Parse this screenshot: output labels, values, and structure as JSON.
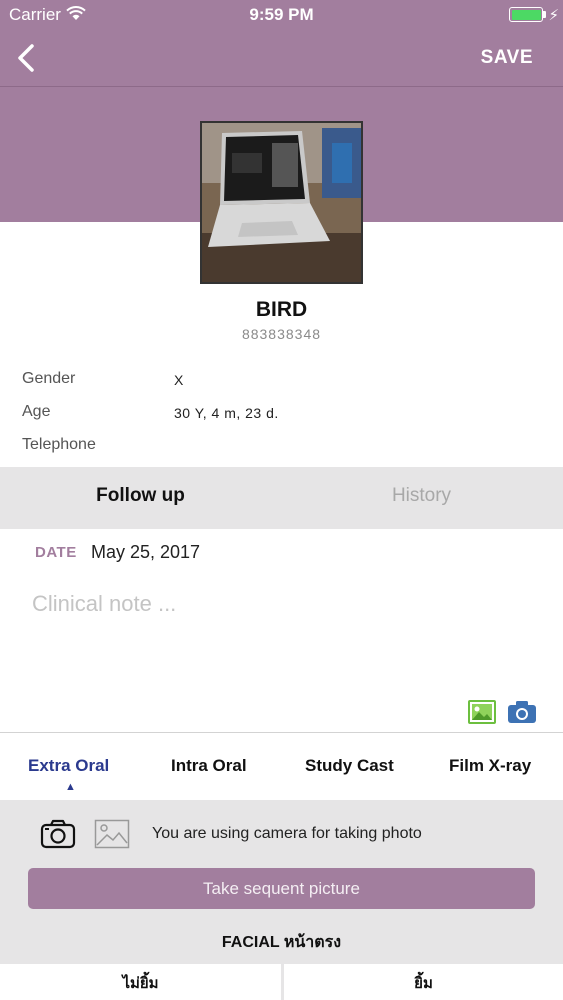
{
  "status_bar": {
    "carrier": "Carrier",
    "time": "9:59 PM"
  },
  "nav": {
    "save_label": "SAVE"
  },
  "patient": {
    "name": "BIRD",
    "id": "883838348",
    "fields": [
      {
        "label": "Gender",
        "value": "X"
      },
      {
        "label": "Age",
        "value": "30 Y, 4 m, 23 d."
      },
      {
        "label": "Telephone",
        "value": ""
      }
    ]
  },
  "tabs": [
    {
      "label": "Follow up"
    },
    {
      "label": "History"
    }
  ],
  "note": {
    "date_label": "DATE",
    "date_value": "May 25, 2017",
    "placeholder": "Clinical note ..."
  },
  "photo_categories": [
    {
      "label": "Extra Oral"
    },
    {
      "label": "Intra Oral"
    },
    {
      "label": "Study Cast"
    },
    {
      "label": "Film X-ray"
    }
  ],
  "capture": {
    "mode_text": "You are using camera for taking photo",
    "take_button": "Take sequent picture",
    "section_title": "FACIAL หน้าตรง",
    "options": [
      "ไม่ยิ้ม",
      "ยิ้ม"
    ]
  },
  "colors": {
    "accent": "#a27e9e",
    "active_tab": "#2b3a8e",
    "battery": "#4cd964"
  }
}
